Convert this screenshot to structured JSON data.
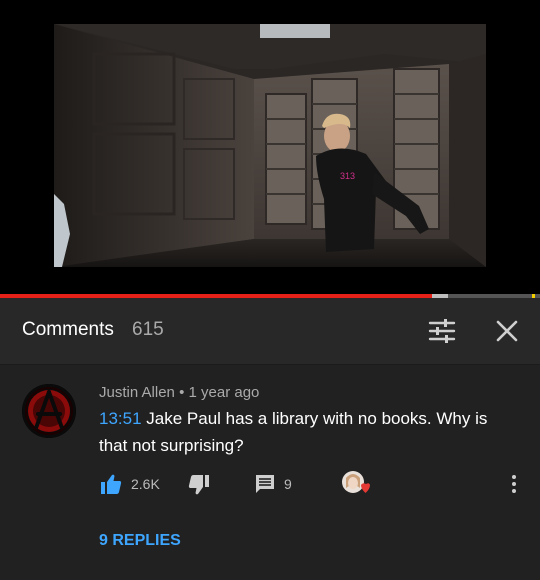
{
  "video": {
    "progress_fraction": 0.8,
    "buffer_fraction": 0.83,
    "shirt_text": "313"
  },
  "comments_header": {
    "title": "Comments",
    "count": "615",
    "icons": {
      "filter": "sort-filter-icon",
      "close": "close-icon"
    }
  },
  "comment": {
    "author": "Justin Allen",
    "separator": "•",
    "time_ago": "1 year ago",
    "timestamp_link": "13:51",
    "text": "Jake Paul has a library with no books. Why is that not surprising?",
    "like_count": "2.6K",
    "reply_count": "9",
    "replies_link": "9 REPLIES",
    "icons": {
      "like": "thumbs-up-icon",
      "dislike": "thumbs-down-icon",
      "reply": "reply-comment-icon",
      "heart": "creator-heart-icon",
      "more": "more-vertical-icon"
    }
  },
  "colors": {
    "accent_red": "#e62117",
    "link_blue": "#3ea6ff",
    "background": "#212121",
    "header_bg": "#282828"
  }
}
